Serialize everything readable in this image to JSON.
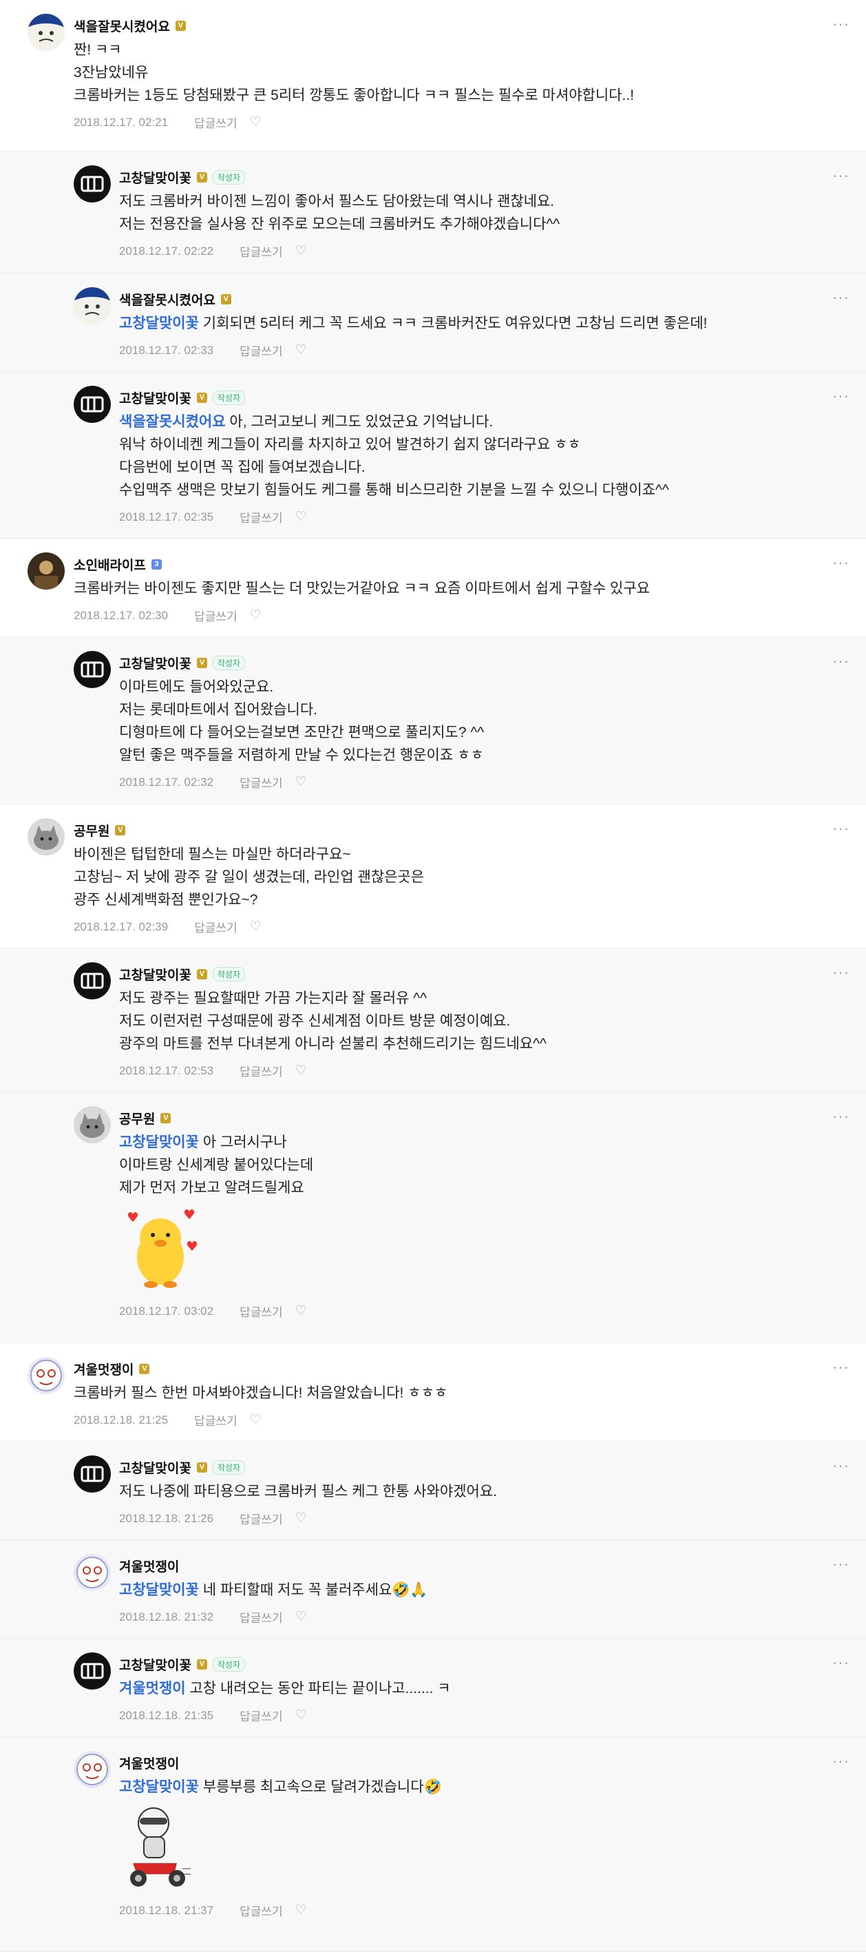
{
  "comments": [
    {
      "nickname": "색을잘못시켰어요",
      "badge": "V",
      "lines": [
        "짠! ㅋㅋ",
        "3잔남았네유",
        "크롬바커는 1등도 당첨돼봤구 큰 5리터 깡통도 좋아합니다 ㅋㅋ 필스는 필수로 마셔야합니다..!"
      ],
      "time": "2018.12.17. 02:21",
      "reply_label": "답글쓰기"
    },
    {
      "nickname": "고창달맞이꽃",
      "badge": "V",
      "author_badge": "작성자",
      "lines": [
        "저도 크롬바커 바이젠 느낌이 좋아서 필스도 담아왔는데 역시나 괜찮네요.",
        "저는 전용잔을 실사용 잔 위주로 모으는데 크롬바커도 추가해야겠습니다^^"
      ],
      "time": "2018.12.17. 02:22",
      "reply_label": "답글쓰기"
    },
    {
      "nickname": "색을잘못시켰어요",
      "badge": "V",
      "mention": "고창달맞이꽃",
      "lines": [
        "기회되면 5리터 케그 꼭 드세요 ㅋㅋ 크롬바커잔도 여유있다면 고창님 드리면 좋은데!"
      ],
      "time": "2018.12.17. 02:33",
      "reply_label": "답글쓰기"
    },
    {
      "nickname": "고창달맞이꽃",
      "badge": "V",
      "author_badge": "작성자",
      "mention": "색을잘못시켰어요",
      "lines": [
        "아, 그러고보니 케그도 있었군요 기억납니다.",
        "워낙 하이네켄 케그들이 자리를 차지하고 있어 발견하기 쉽지 않더라구요 ㅎㅎ",
        "다음번에 보이면 꼭 집에 들여보겠습니다.",
        "수입맥주 생맥은 맛보기 힘들어도 케그를 통해 비스므리한 기분을 느낄 수 있으니 다행이죠^^"
      ],
      "time": "2018.12.17. 02:35",
      "reply_label": "답글쓰기"
    },
    {
      "nickname": "소인배라이프",
      "badge": "3",
      "lines": [
        "크롬바커는 바이젠도 좋지만 필스는 더 맛있는거같아요 ㅋㅋ 요즘 이마트에서 쉽게 구할수 있구요"
      ],
      "time": "2018.12.17. 02:30",
      "reply_label": "답글쓰기"
    },
    {
      "nickname": "고창달맞이꽃",
      "badge": "V",
      "author_badge": "작성자",
      "lines": [
        "이마트에도 들어와있군요.",
        "저는 롯데마트에서 집어왔습니다.",
        "디형마트에 다 들어오는걸보면 조만간 편맥으로 풀리지도? ^^",
        "알턴 좋은 맥주들을 저렴하게 만날 수 있다는건 행운이죠 ㅎㅎ"
      ],
      "time": "2018.12.17. 02:32",
      "reply_label": "답글쓰기"
    },
    {
      "nickname": "공무원",
      "badge": "V",
      "lines": [
        "바이젠은 텁텁한데 필스는 마실만 하더라구요~",
        "고창님~ 저 낮에 광주 갈 일이 생겼는데, 라인업 괜찮은곳은",
        "광주 신세계백화점 뿐인가요~?"
      ],
      "time": "2018.12.17. 02:39",
      "reply_label": "답글쓰기"
    },
    {
      "nickname": "고창달맞이꽃",
      "badge": "V",
      "author_badge": "작성자",
      "lines": [
        "저도 광주는 필요할때만 가끔 가는지라 잘 몰러유 ^^",
        "저도 이런저런 구성때문에 광주 신세계점 이마트 방문 예정이예요.",
        "광주의 마트를 전부 다녀본게 아니라 섣불리 추천해드리기는 힘드네요^^"
      ],
      "time": "2018.12.17. 02:53",
      "reply_label": "답글쓰기"
    },
    {
      "nickname": "공무원",
      "badge": "V",
      "mention": "고창달맞이꽃",
      "lines": [
        "아 그러시구나",
        "이마트랑 신세계랑 붙어있다는데",
        "제가 먼저 가보고 알려드릴게요"
      ],
      "time": "2018.12.17. 03:02",
      "reply_label": "답글쓰기"
    },
    {
      "nickname": "겨울멋쟁이",
      "badge": "V",
      "lines": [
        "크롬바커 필스 한번 마셔봐야겠습니다! 처음알았습니다! ㅎㅎㅎ"
      ],
      "time": "2018.12.18. 21:25",
      "reply_label": "답글쓰기"
    },
    {
      "nickname": "고창달맞이꽃",
      "badge": "V",
      "author_badge": "작성자",
      "lines": [
        "저도 나중에 파티용으로 크롬바커 필스 케그 한통 사와야겠어요."
      ],
      "time": "2018.12.18. 21:26",
      "reply_label": "답글쓰기"
    },
    {
      "nickname": "겨울멋쟁이",
      "mention": "고창달맞이꽃",
      "lines": [
        "네 파티할때 저도 꼭 불러주세요🤣🙏"
      ],
      "time": "2018.12.18. 21:32",
      "reply_label": "답글쓰기"
    },
    {
      "nickname": "고창달맞이꽃",
      "badge": "V",
      "author_badge": "작성자",
      "mention": "겨울멋쟁이",
      "lines": [
        "고창 내려오는 동안 파티는 끝이나고....... ㅋ"
      ],
      "time": "2018.12.18. 21:35",
      "reply_label": "답글쓰기"
    },
    {
      "nickname": "겨울멋쟁이",
      "mention": "고창달맞이꽃",
      "lines": [
        "부릉부릉 최고속으로 달려가겠습니다🤣"
      ],
      "time": "2018.12.18. 21:37",
      "reply_label": "답글쓰기"
    }
  ],
  "ui": {
    "more_label": "···",
    "heart_icon": "heart-outline-icon"
  }
}
